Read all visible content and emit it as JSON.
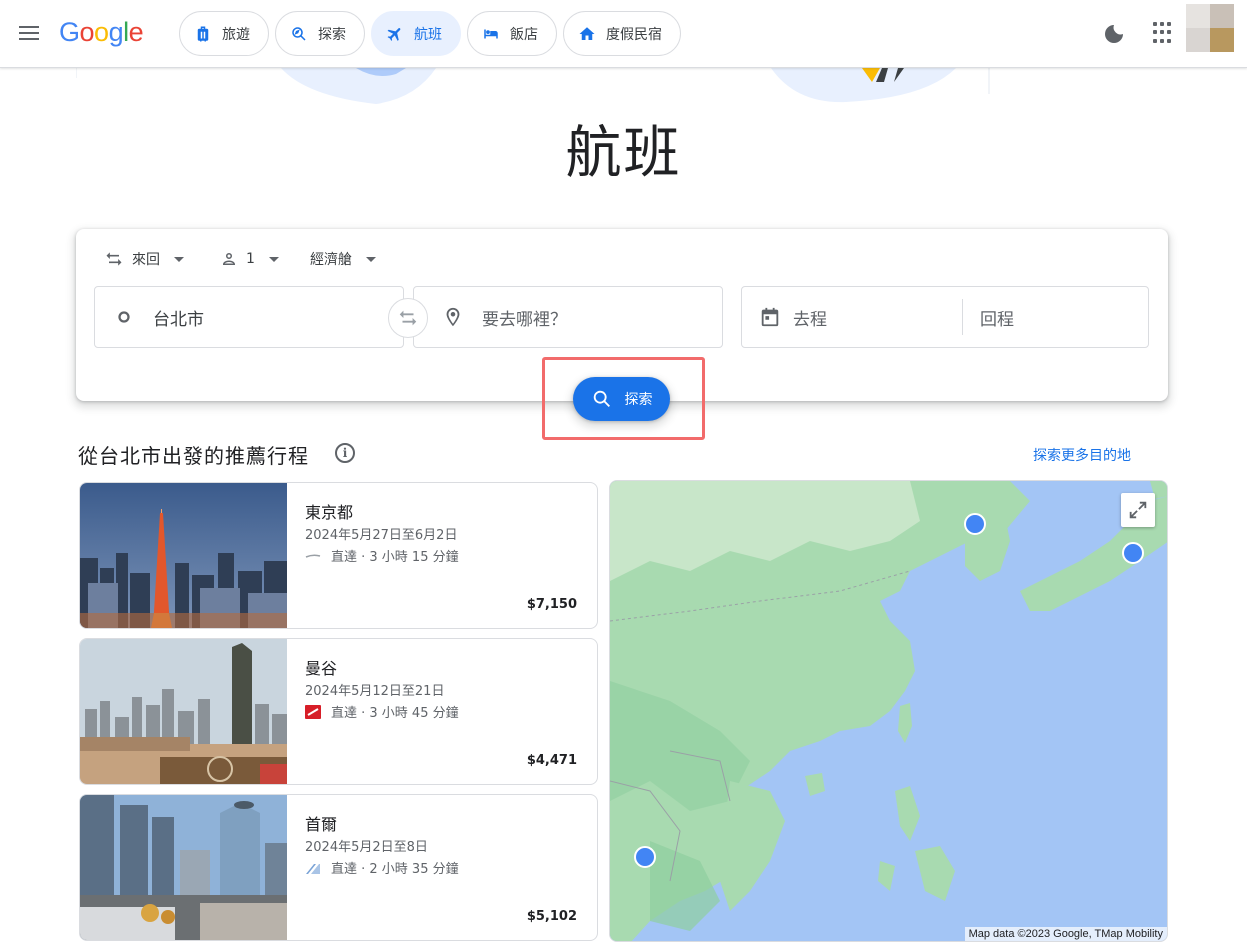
{
  "header": {
    "logo_text": "Google",
    "nav_chips": [
      {
        "label": "旅遊",
        "icon": "luggage-icon",
        "active": false
      },
      {
        "label": "探索",
        "icon": "explore-icon",
        "active": false
      },
      {
        "label": "航班",
        "icon": "airplane-icon",
        "active": true
      },
      {
        "label": "飯店",
        "icon": "bed-icon",
        "active": false
      },
      {
        "label": "度假民宿",
        "icon": "house-icon",
        "active": false
      }
    ],
    "theme_icon": "moon-icon",
    "apps_icon": "apps-grid-icon"
  },
  "page_title": "航班",
  "search": {
    "trip_type": "來回",
    "passengers": "1",
    "cabin_class": "經濟艙",
    "origin_value": "台北市",
    "destination_placeholder": "要去哪裡？",
    "depart_placeholder": "去程",
    "return_placeholder": "回程",
    "search_button_label": "探索",
    "accent_color": "#1a73e8"
  },
  "recommendations": {
    "title": "從台北市出發的推薦行程",
    "explore_more_label": "探索更多目的地",
    "items": [
      {
        "city": "東京都",
        "dates": "2024年5月27日至6月2日",
        "route": "直達 · 3 小時 15 分鐘",
        "price": "$7,150"
      },
      {
        "city": "曼谷",
        "dates": "2024年5月12日至21日",
        "route": "直達 · 3 小時 45 分鐘",
        "price": "$4,471"
      },
      {
        "city": "首爾",
        "dates": "2024年5月2日至8日",
        "route": "直達 · 2 小時 35 分鐘",
        "price": "$5,102"
      }
    ]
  },
  "map": {
    "attribution": "Map data ©2023 Google, TMap Mobility"
  }
}
